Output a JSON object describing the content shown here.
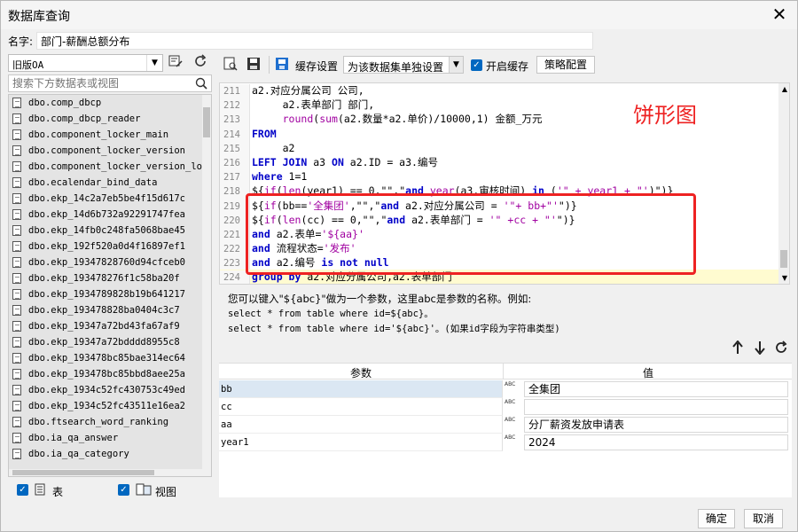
{
  "window": {
    "title": "数据库查询",
    "close_label": "✕"
  },
  "name_row": {
    "label": "名字:",
    "value": "部门-薪酬总额分布"
  },
  "left": {
    "db_select_value": "旧版OA",
    "search_placeholder": "搜索下方数据表或视图",
    "tables": [
      "dbo.comp_dbcp",
      "dbo.comp_dbcp_reader",
      "dbo.component_locker_main",
      "dbo.component_locker_version",
      "dbo.component_locker_version_log",
      "dbo.ecalendar_bind_data",
      "dbo.ekp_14c2a7eb5be4f15d617c",
      "dbo.ekp_14d6b732a92291747fea",
      "dbo.ekp_14fb0c248fa5068bae45",
      "dbo.ekp_192f520a0d4f16897ef1",
      "dbo.ekp_19347828760d94cfceb0",
      "dbo.ekp_193478276f1c58ba20f",
      "dbo.ekp_1934789828b19b641217",
      "dbo.ekp_193478828ba0404c3c7",
      "dbo.ekp_19347a72bd43fa67af9",
      "dbo.ekp_19347a72bdddd8955c8",
      "dbo.ekp_193478bc85bae314ec64",
      "dbo.ekp_193478bc85bbd8aee25a",
      "dbo.ekp_1934c52fc430753c49ed",
      "dbo.ekp_1934c52fc43511e16ea2",
      "dbo.ftsearch_word_ranking",
      "dbo.ia_qa_answer",
      "dbo.ia_qa_category"
    ],
    "check_table_label": "表",
    "check_view_label": "视图"
  },
  "toolbar": {
    "cache_settings": "缓存设置",
    "cache_mode": "为该数据集单独设置",
    "enable_cache": "开启缓存",
    "strategy_button": "策略配置"
  },
  "editor": {
    "annotation": "饼形图",
    "lines": [
      {
        "no": "211",
        "text": "a2.对应分属公司 公司,"
      },
      {
        "no": "212",
        "text": "     a2.表单部门 部门,"
      },
      {
        "no": "213",
        "text": "     round(sum(a2.数量*a2.单价)/10000,1) 金额_万元"
      },
      {
        "no": "214",
        "text": "FROM"
      },
      {
        "no": "215",
        "text": "     a2"
      },
      {
        "no": "216",
        "text": "LEFT JOIN a3 ON a2.ID = a3.编号"
      },
      {
        "no": "217",
        "text": "where 1=1"
      },
      {
        "no": "218",
        "text": "${if(len(year1) == 0,\"\",\"and year(a3.审核时间) in ('\" + year1 + \"')\")}"
      },
      {
        "no": "219",
        "text": "${if(bb=='全集团',\"\",\"and a2.对应分属公司 = '\"+ bb+\"'\")}"
      },
      {
        "no": "220",
        "text": "${if(len(cc) == 0,\"\",\"and a2.表单部门 = '\" +cc + \"'\")}"
      },
      {
        "no": "221",
        "text": "and a2.表单='${aa}'"
      },
      {
        "no": "222",
        "text": "and 流程状态='发布'"
      },
      {
        "no": "223",
        "text": "and a2.编号 is not null"
      },
      {
        "no": "224",
        "text": "group by a2.对应分属公司,a2.表单部门"
      }
    ]
  },
  "help": {
    "line1": "您可以键入\"${abc}\"做为一个参数，这里abc是参数的名称。例如:",
    "line2": "select * from table where id=${abc}。",
    "line3": "select * from table where id='${abc}'。(如果id字段为字符串类型)"
  },
  "params": {
    "header_name": "参数",
    "header_value": "值",
    "rows": [
      {
        "name": "bb",
        "value": "全集团"
      },
      {
        "name": "cc",
        "value": ""
      },
      {
        "name": "aa",
        "value": "分厂薪资发放申请表"
      },
      {
        "name": "year1",
        "value": "2024"
      }
    ],
    "type_badge": "ABC"
  },
  "footer": {
    "ok": "确定",
    "cancel": "取消"
  },
  "colors": {
    "accent": "#0067c0",
    "highlight_box": "#ee2222",
    "keyword": "#0000c8",
    "string": "#a000a0"
  }
}
